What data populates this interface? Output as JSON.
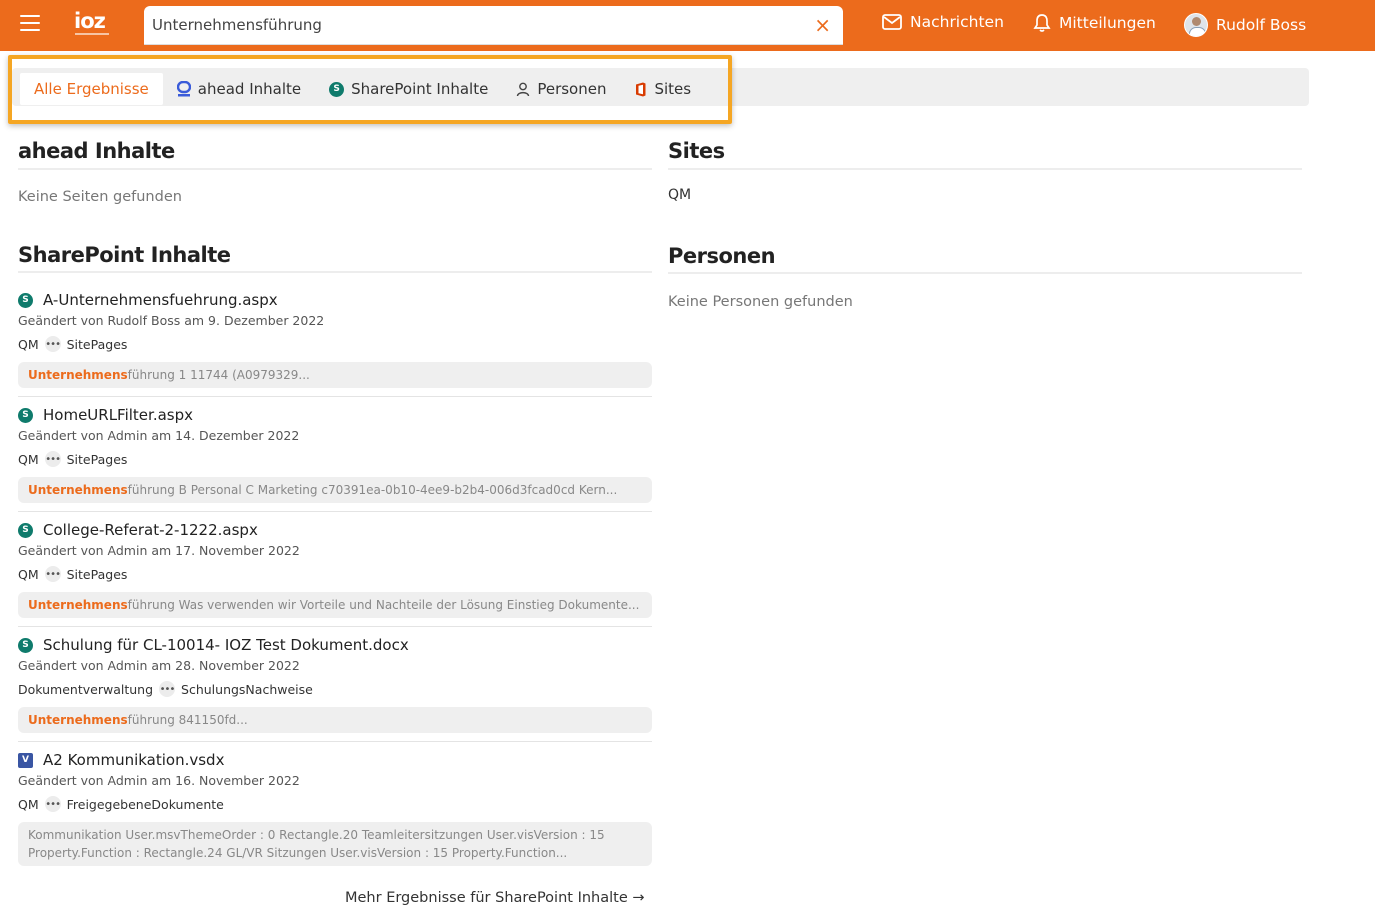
{
  "header": {
    "logo": "ioz",
    "search_value": "Unternehmensführung",
    "clear_icon": "×",
    "nav": [
      {
        "label": "Nachrichten",
        "icon": "mail-icon"
      },
      {
        "label": "Mitteilungen",
        "icon": "bell-icon"
      },
      {
        "label": "Rudolf Boss",
        "icon": "avatar"
      }
    ]
  },
  "tabs": [
    {
      "label": "Alle Ergebnisse",
      "active": true
    },
    {
      "label": "ahead Inhalte",
      "icon": "ahead-icon"
    },
    {
      "label": "SharePoint Inhalte",
      "icon": "sharepoint-icon"
    },
    {
      "label": "Personen",
      "icon": "person-icon"
    },
    {
      "label": "Sites",
      "icon": "office-icon"
    }
  ],
  "ahead": {
    "title": "ahead Inhalte",
    "empty": "Keine Seiten gefunden"
  },
  "sharepoint": {
    "title": "SharePoint Inhalte",
    "results": [
      {
        "title": "A-Unternehmensfuehrung.aspx",
        "meta": "Geändert von Rudolf Boss am 9. Dezember 2022",
        "site": "QM",
        "library": "SitePages",
        "snippet_hl": "Unternehmens",
        "snippet": "führung 1 11744 (A0979329..."
      },
      {
        "title": "HomeURLFilter.aspx",
        "meta": "Geändert von Admin am 14. Dezember 2022",
        "site": "QM",
        "library": "SitePages",
        "snippet_hl": "Unternehmens",
        "snippet": "führung B Personal C Marketing c70391ea-0b10-4ee9-b2b4-006d3fcad0cd Kern..."
      },
      {
        "title": "College-Referat-2-1222.aspx",
        "meta": "Geändert von Admin am 17. November 2022",
        "site": "QM",
        "library": "SitePages",
        "snippet_hl": "Unternehmens",
        "snippet": "führung Was verwenden wir Vorteile und Nachteile der Lösung Einstieg Dokumente..."
      },
      {
        "title": "Schulung für CL-10014- IOZ Test Dokument.docx",
        "meta": "Geändert von Admin am 28. November 2022",
        "site": "Dokumentverwaltung",
        "library": "SchulungsNachweise",
        "snippet_hl": "Unternehmens",
        "snippet": "führung 841150fd..."
      },
      {
        "title": "A2 Kommunikation.vsdx",
        "meta": "Geändert von Admin am 16. November 2022",
        "site": "QM",
        "library": "FreigegebeneDokumente",
        "snippet_line1": "Kommunikation User.msvThemeOrder : 0 Rectangle.20 Teamleitersitzungen User.visVersion : 15",
        "snippet_line2": "Property.Function : Rectangle.24 GL/VR Sitzungen User.visVersion : 15 Property.Function..."
      }
    ],
    "more": "Mehr Ergebnisse für SharePoint Inhalte →"
  },
  "sites": {
    "title": "Sites",
    "items": [
      "QM"
    ]
  },
  "personen": {
    "title": "Personen",
    "empty": "Keine Personen gefunden"
  },
  "colors": {
    "brand": "#ec6b1c",
    "highlight_frame": "#f5a623"
  }
}
